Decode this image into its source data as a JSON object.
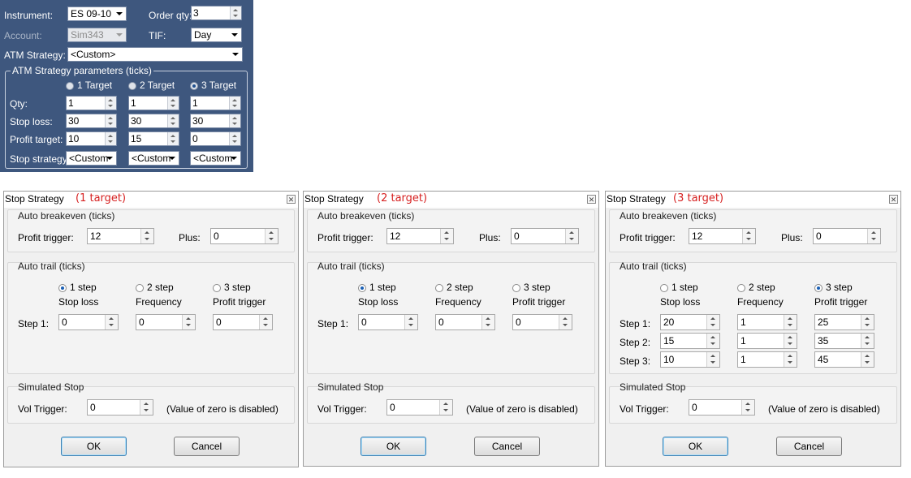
{
  "order_panel": {
    "instrument_label": "Instrument:",
    "instrument_value": "ES 09-10",
    "order_qty_label": "Order qty:",
    "order_qty_value": "3",
    "account_label": "Account:",
    "account_value": "Sim343",
    "tif_label": "TIF:",
    "tif_value": "Day",
    "atm_strategy_label": "ATM Strategy:",
    "atm_strategy_value": "<Custom>",
    "params_group_title": "ATM Strategy parameters (ticks)",
    "targets": [
      "1 Target",
      "2 Target",
      "3 Target"
    ],
    "selected_target": 2,
    "row_labels": {
      "qty": "Qty:",
      "stop_loss": "Stop loss:",
      "profit_target": "Profit target:",
      "stop_strategy": "Stop strategy:"
    },
    "qty": [
      "1",
      "1",
      "1"
    ],
    "stop_loss": [
      "30",
      "30",
      "30"
    ],
    "profit_target": [
      "10",
      "15",
      "0"
    ],
    "stop_strategy": [
      "<Custom",
      "<Custom",
      "<Custom"
    ]
  },
  "dialogs": [
    {
      "title": "Stop Strategy",
      "annotation": "(1 target)",
      "auto_breakeven_title": "Auto breakeven (ticks)",
      "profit_trigger_label": "Profit trigger:",
      "profit_trigger": "12",
      "plus_label": "Plus:",
      "plus": "0",
      "auto_trail_title": "Auto trail (ticks)",
      "step_options": [
        "1 step",
        "2 step",
        "3 step"
      ],
      "selected_step": 0,
      "col_headers": [
        "Stop loss",
        "Frequency",
        "Profit trigger"
      ],
      "step_labels": [
        "Step 1:"
      ],
      "steps": [
        [
          "0",
          "0",
          "0"
        ]
      ],
      "simulated_stop_title": "Simulated Stop",
      "vol_trigger_label": "Vol Trigger:",
      "vol_trigger": "0",
      "vol_note": "(Value of zero is disabled)",
      "ok_label": "OK",
      "cancel_label": "Cancel"
    },
    {
      "title": "Stop Strategy",
      "annotation": "(2 target)",
      "auto_breakeven_title": "Auto breakeven (ticks)",
      "profit_trigger_label": "Profit trigger:",
      "profit_trigger": "12",
      "plus_label": "Plus:",
      "plus": "0",
      "auto_trail_title": "Auto trail (ticks)",
      "step_options": [
        "1 step",
        "2 step",
        "3 step"
      ],
      "selected_step": 0,
      "col_headers": [
        "Stop loss",
        "Frequency",
        "Profit trigger"
      ],
      "step_labels": [
        "Step 1:"
      ],
      "steps": [
        [
          "0",
          "0",
          "0"
        ]
      ],
      "simulated_stop_title": "Simulated Stop",
      "vol_trigger_label": "Vol Trigger:",
      "vol_trigger": "0",
      "vol_note": "(Value of zero is disabled)",
      "ok_label": "OK",
      "cancel_label": "Cancel"
    },
    {
      "title": "Stop Strategy",
      "annotation": "(3 target)",
      "auto_breakeven_title": "Auto breakeven (ticks)",
      "profit_trigger_label": "Profit trigger:",
      "profit_trigger": "12",
      "plus_label": "Plus:",
      "plus": "0",
      "auto_trail_title": "Auto trail (ticks)",
      "step_options": [
        "1 step",
        "2 step",
        "3 step"
      ],
      "selected_step": 2,
      "col_headers": [
        "Stop loss",
        "Frequency",
        "Profit trigger"
      ],
      "step_labels": [
        "Step 1:",
        "Step 2:",
        "Step 3:"
      ],
      "steps": [
        [
          "20",
          "1",
          "25"
        ],
        [
          "15",
          "1",
          "35"
        ],
        [
          "10",
          "1",
          "45"
        ]
      ],
      "simulated_stop_title": "Simulated Stop",
      "vol_trigger_label": "Vol Trigger:",
      "vol_trigger": "0",
      "vol_note": "(Value of zero is disabled)",
      "ok_label": "OK",
      "cancel_label": "Cancel"
    }
  ],
  "colors": {
    "panel_bg": "#3e577e",
    "annotation": "#d62020",
    "dialog_bg": "#f0f0f0"
  }
}
